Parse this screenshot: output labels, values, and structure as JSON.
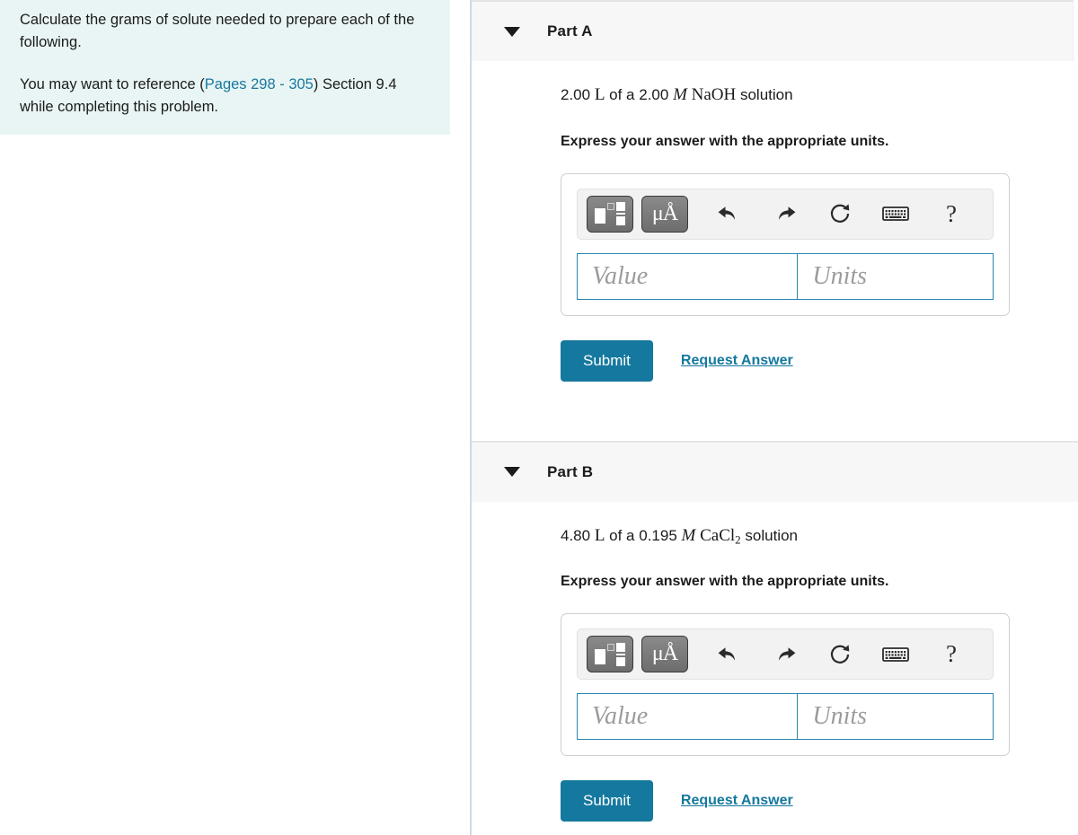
{
  "problem": {
    "paragraph1": "Calculate the grams of solute needed to prepare each of the following.",
    "paragraph2_prefix": "You may want to reference ",
    "paragraph2_open_paren": "(",
    "reference_link": "Pages 298 - 305",
    "paragraph2_suffix": ") Section 9.4 while completing this problem.",
    "panel_color": "#e8f5f4",
    "link_color": "#1878a0"
  },
  "parts": [
    {
      "title": "Part A",
      "caret": "caret-down-icon",
      "question": {
        "qty": "2.00",
        "unit": "L",
        "middle": " of a ",
        "conc": "2.00",
        "molar_symbol": "M",
        "formula": "NaOH",
        "formula_sub": "",
        "tail": " solution"
      },
      "instruction": "Express your answer with the appropriate units.",
      "toolbar": {
        "template_button": "math-template-button",
        "units_button": "μÅ",
        "undo": "undo-icon",
        "redo": "redo-icon",
        "reset": "reset-icon",
        "keyboard": "keyboard-icon",
        "help": "?"
      },
      "value_field": {
        "value": "",
        "placeholder": "Value"
      },
      "units_field": {
        "value": "",
        "placeholder": "Units"
      },
      "submit_label": "Submit",
      "request_answer_label": "Request Answer"
    },
    {
      "title": "Part B",
      "caret": "caret-down-icon",
      "question": {
        "qty": "4.80",
        "unit": "L",
        "middle": " of a ",
        "conc": "0.195",
        "molar_symbol": "M",
        "formula": "CaCl",
        "formula_sub": "2",
        "tail": " solution"
      },
      "instruction": "Express your answer with the appropriate units.",
      "toolbar": {
        "template_button": "math-template-button",
        "units_button": "μÅ",
        "undo": "undo-icon",
        "redo": "redo-icon",
        "reset": "reset-icon",
        "keyboard": "keyboard-icon",
        "help": "?"
      },
      "value_field": {
        "value": "",
        "placeholder": "Value"
      },
      "units_field": {
        "value": "",
        "placeholder": "Units"
      },
      "submit_label": "Submit",
      "request_answer_label": "Request Answer"
    }
  ],
  "colors": {
    "accent": "#15789e",
    "field_border": "#2a87ae",
    "header_bg": "#f7f7f7",
    "panel_bg": "#e8f5f4"
  }
}
